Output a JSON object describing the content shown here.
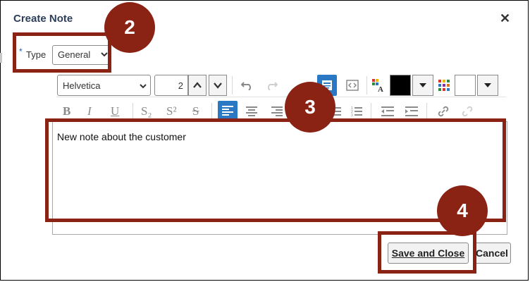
{
  "dialog": {
    "title": "Create Note",
    "close_glyph": "✕"
  },
  "type_field": {
    "required_marker": "*",
    "label": "Type",
    "value": "General"
  },
  "toolbar": {
    "font_family": "Helvetica",
    "font_size": "2",
    "text_color": "#000000",
    "background_color": "#ffffff",
    "format_buttons": {
      "bold": "B",
      "italic": "I",
      "underline": "U",
      "subscript": "S₂",
      "superscript": "S²",
      "strikethrough": "S"
    }
  },
  "editor": {
    "content": "New note about the customer"
  },
  "buttons": {
    "save_and_close": "Save and Close",
    "cancel": "Cancel"
  },
  "callouts": [
    "2",
    "3",
    "4"
  ],
  "colors": {
    "accent": "#2a78c4",
    "callout": "#8b2315",
    "title": "#2c3e59"
  }
}
